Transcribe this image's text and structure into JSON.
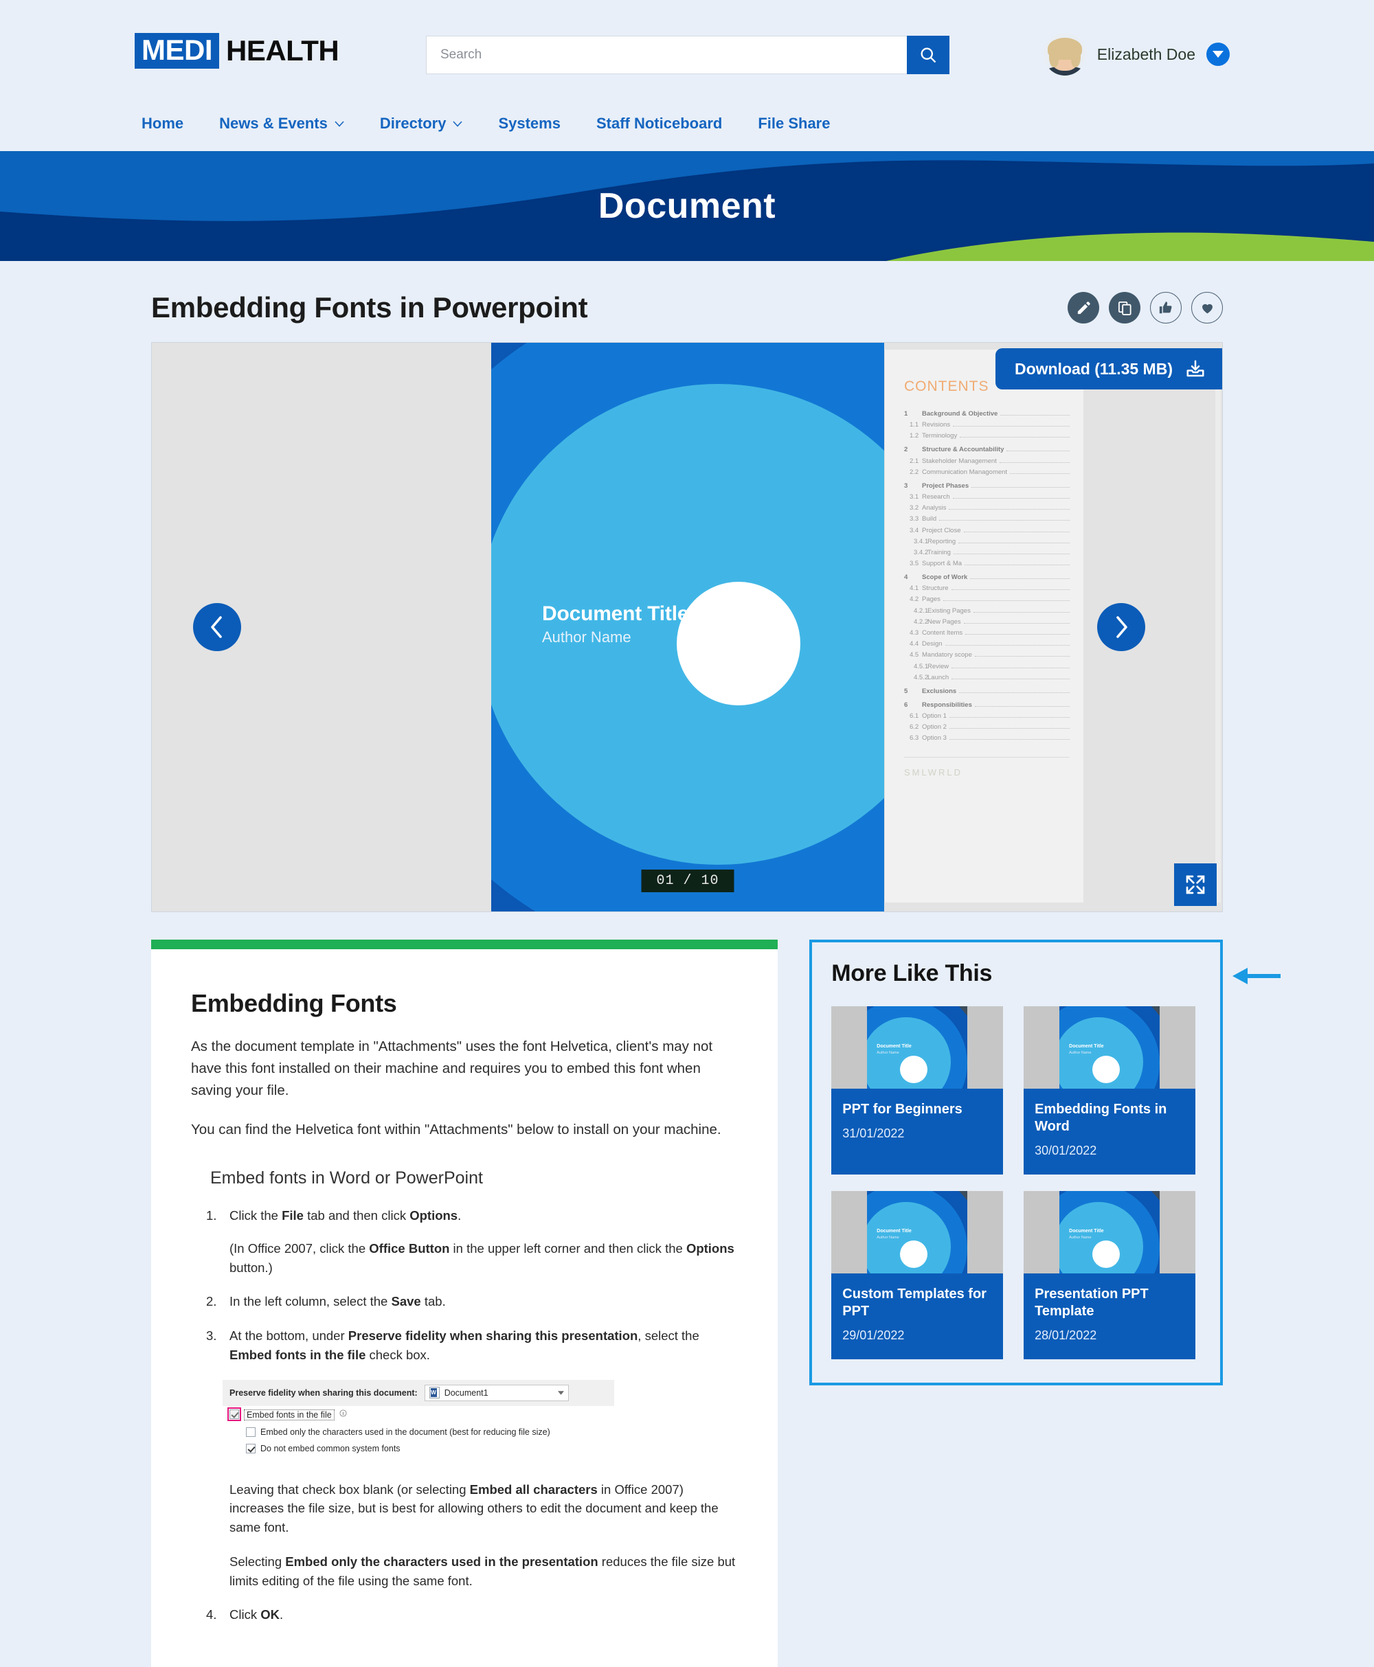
{
  "header": {
    "logo_primary": "MEDI",
    "logo_secondary": "HEALTH",
    "search_placeholder": "Search",
    "search_value": "",
    "user_name": "Elizabeth Doe"
  },
  "nav": {
    "items": [
      {
        "label": "Home",
        "has_caret": false
      },
      {
        "label": "News & Events",
        "has_caret": true
      },
      {
        "label": "Directory",
        "has_caret": true
      },
      {
        "label": "Systems",
        "has_caret": false
      },
      {
        "label": "Staff Noticeboard",
        "has_caret": false
      },
      {
        "label": "File Share",
        "has_caret": false
      }
    ]
  },
  "hero": {
    "title": "Document"
  },
  "doc": {
    "title": "Embedding Fonts in Powerpoint",
    "actions": [
      {
        "icon": "pencil-icon",
        "name": "edit-button"
      },
      {
        "icon": "copy-icon",
        "name": "copy-button"
      },
      {
        "icon": "thumbs-up-icon",
        "name": "like-button"
      },
      {
        "icon": "heart-icon",
        "name": "favorite-button"
      }
    ]
  },
  "viewer": {
    "download_label": "Download (11.35 MB)",
    "page_indicator": "01 / 10",
    "slide": {
      "title": "Document Title",
      "author": "Author Name"
    },
    "contents": {
      "heading": "CONTENTS",
      "brand": "SMLWRLD",
      "rows": [
        {
          "num": "1",
          "label": "Background & Objective",
          "level": 1
        },
        {
          "num": "1.1",
          "label": "Revisions",
          "level": 2
        },
        {
          "num": "1.2",
          "label": "Terminology",
          "level": 2
        },
        {
          "num": "2",
          "label": "Structure & Accountability",
          "level": 1
        },
        {
          "num": "2.1",
          "label": "Stakeholder Management",
          "level": 2
        },
        {
          "num": "2.2",
          "label": "Communication Managoment",
          "level": 2
        },
        {
          "num": "3",
          "label": "Project Phases",
          "level": 1
        },
        {
          "num": "3.1",
          "label": "Research",
          "level": 2
        },
        {
          "num": "3.2",
          "label": "Analysis",
          "level": 2
        },
        {
          "num": "3.3",
          "label": "Build",
          "level": 2
        },
        {
          "num": "3.4",
          "label": "Project Close",
          "level": 2
        },
        {
          "num": "3.4.1",
          "label": "Reporting",
          "level": 3
        },
        {
          "num": "3.4.2",
          "label": "Training",
          "level": 3
        },
        {
          "num": "3.5",
          "label": "Support & Ma",
          "level": 2
        },
        {
          "num": "4",
          "label": "Scope of Work",
          "level": 1
        },
        {
          "num": "4.1",
          "label": "Structure",
          "level": 2
        },
        {
          "num": "4.2",
          "label": "Pages",
          "level": 2
        },
        {
          "num": "4.2.1",
          "label": "Existing Pages",
          "level": 3
        },
        {
          "num": "4.2.2",
          "label": "New Pages",
          "level": 3
        },
        {
          "num": "4.3",
          "label": "Content Items",
          "level": 2
        },
        {
          "num": "4.4",
          "label": "Design",
          "level": 2
        },
        {
          "num": "4.5",
          "label": "Mandatory scope",
          "level": 2
        },
        {
          "num": "4.5.1",
          "label": "Review",
          "level": 3
        },
        {
          "num": "4.5.2",
          "label": "Launch",
          "level": 3
        },
        {
          "num": "5",
          "label": "Exclusions",
          "level": 1
        },
        {
          "num": "6",
          "label": "Responsibilities",
          "level": 1
        },
        {
          "num": "6.1",
          "label": "Option 1",
          "level": 2
        },
        {
          "num": "6.2",
          "label": "Option 2",
          "level": 2
        },
        {
          "num": "6.3",
          "label": "Option 3",
          "level": 2
        }
      ]
    }
  },
  "article": {
    "heading": "Embedding Fonts",
    "para1": "As the document template in \"Attachments\" uses the font Helvetica, client's may not have this font installed on their machine and requires you to embed this font when saving your file.",
    "para2": "You can find the Helvetica font within \"Attachments\" below to install on your machine.",
    "subheading": "Embed fonts in Word or PowerPoint",
    "step1_a": "Click the ",
    "step1_b": "File",
    "step1_c": " tab and then click ",
    "step1_d": "Options",
    "step1_e": ".",
    "step1_note_a": "(In Office 2007, click the ",
    "step1_note_b": "Office Button",
    "step1_note_c": " in the upper left corner and then click the ",
    "step1_note_d": "Options",
    "step1_note_e": " button.)",
    "step2_a": "In the left column, select the ",
    "step2_b": "Save",
    "step2_c": " tab.",
    "step3_a": "At the bottom, under ",
    "step3_b": "Preserve fidelity when sharing this presentation",
    "step3_c": ", select the ",
    "step3_d": "Embed fonts in the file",
    "step3_e": " check box.",
    "step4_a": "Click ",
    "step4_b": "OK",
    "step4_c": ".",
    "after_a": "Leaving that check box blank (or selecting ",
    "after_b": "Embed all characters",
    "after_c": " in Office 2007) increases the file size, but is best for allowing others to edit the document and keep the same font.",
    "after2_a": "Selecting ",
    "after2_b": "Embed only the characters used in the presentation",
    "after2_c": " reduces the file size but limits editing of the file using the same font.",
    "office_shot": {
      "label": "Preserve fidelity when sharing this document:",
      "select_value": "Document1",
      "opt1": "Embed fonts in the file",
      "opt2": "Embed only the characters used in the document (best for reducing file size)",
      "opt3": "Do not embed common system fonts"
    }
  },
  "more_like_this": {
    "heading": "More Like This",
    "cards": [
      {
        "title": "PPT for Beginners",
        "date": "31/01/2022",
        "thumb_title": "Document Title",
        "thumb_author": "Author Name"
      },
      {
        "title": "Embedding Fonts in Word",
        "date": "30/01/2022",
        "thumb_title": "Document Title",
        "thumb_author": "Author Name"
      },
      {
        "title": "Custom Templates for PPT",
        "date": "29/01/2022",
        "thumb_title": "Document Title",
        "thumb_author": "Author Name"
      },
      {
        "title": "Presentation PPT Template",
        "date": "28/01/2022",
        "thumb_title": "Document Title",
        "thumb_author": "Author Name"
      }
    ]
  },
  "colors": {
    "brand_blue": "#0b5cb8",
    "nav_blue": "#1565c0",
    "hero_light": "#0b63bb",
    "hero_dark": "#00357f",
    "hero_green": "#8cc63f",
    "accent_green": "#1faf55",
    "highlight_cyan": "#1a9ae3",
    "pink_highlight": "#e5147d"
  }
}
